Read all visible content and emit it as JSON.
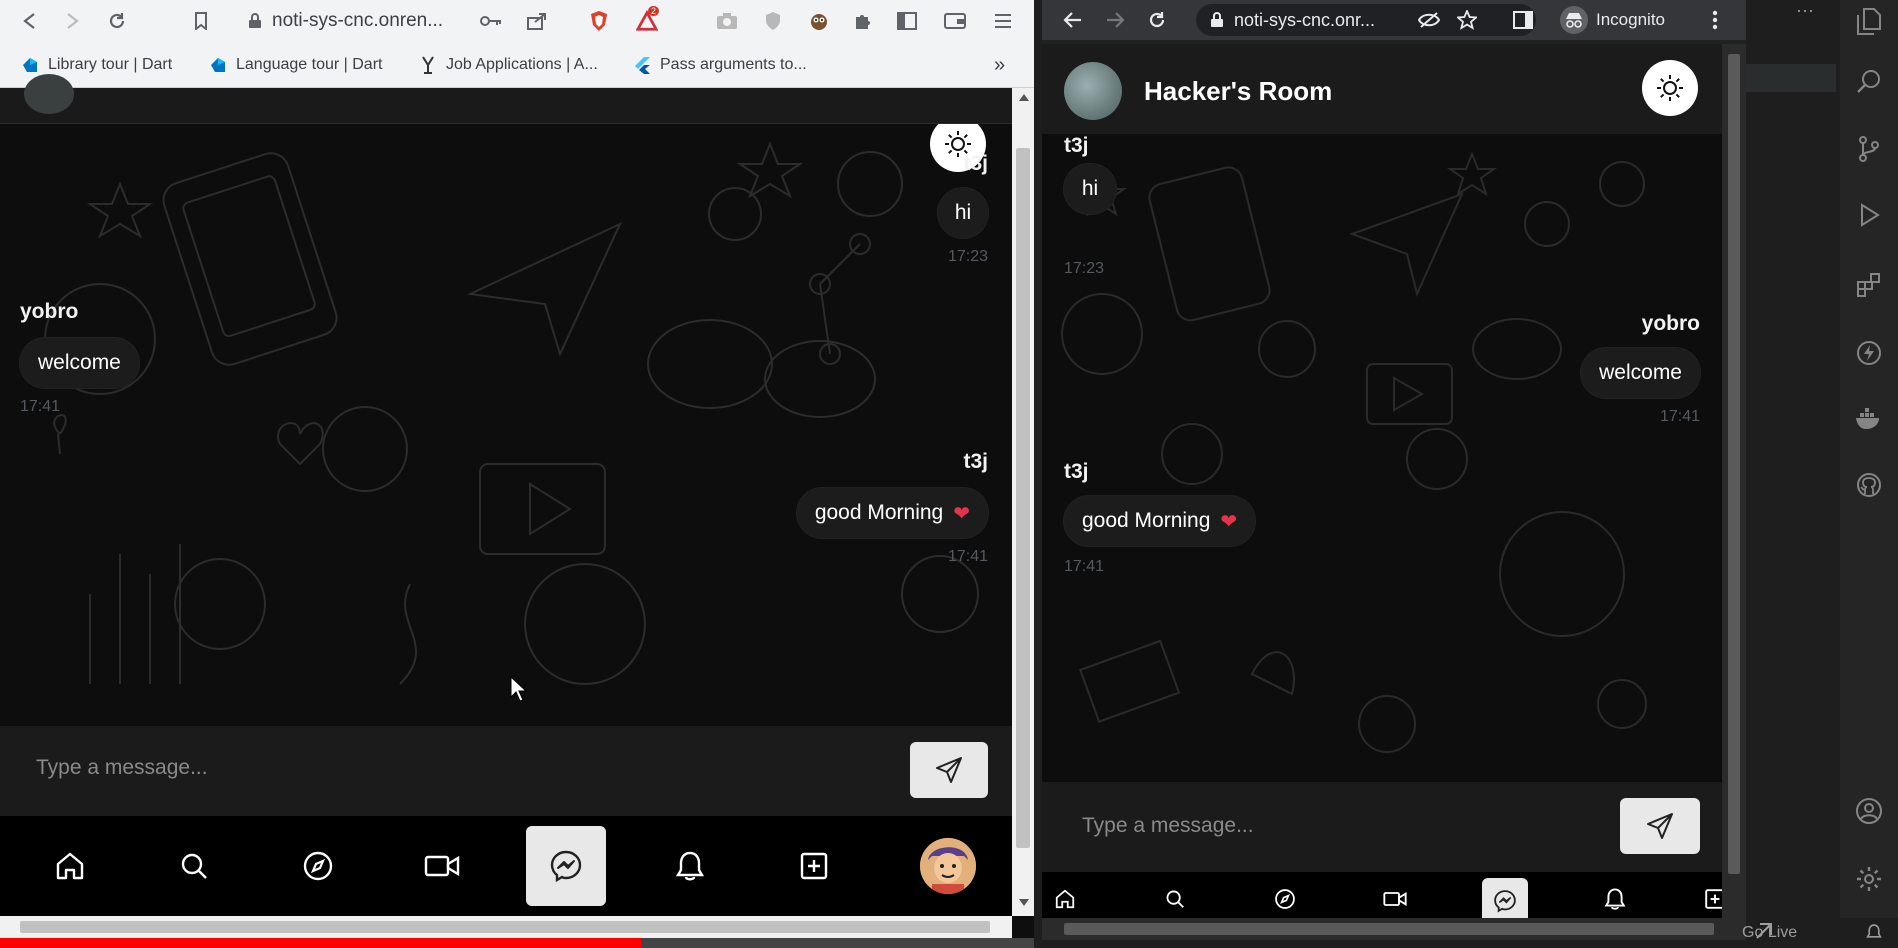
{
  "left_window": {
    "url": "noti-sys-cnc.onren...",
    "extension_badge": "2",
    "bookmarks": [
      {
        "label": "Library tour | Dart",
        "icon": "dart-icon"
      },
      {
        "label": "Language tour | Dart",
        "icon": "dart-icon"
      },
      {
        "label": "Job Applications | A...",
        "icon": "job-icon"
      },
      {
        "label": "Pass arguments to...",
        "icon": "flutter-icon"
      }
    ],
    "bookmarks_more": "»",
    "messages": [
      {
        "sender": "t3j",
        "text": "hi",
        "time": "17:23",
        "side": "right"
      },
      {
        "sender": "yobro",
        "text": "welcome",
        "time": "17:41",
        "side": "left"
      },
      {
        "sender": "t3j",
        "text": "good Morning",
        "emoji": "❤",
        "time": "17:41",
        "side": "right"
      }
    ],
    "input_placeholder": "Type a message...",
    "nav": [
      "home",
      "search",
      "explore",
      "video",
      "messenger",
      "notifications",
      "add",
      "profile"
    ],
    "active_nav": "messenger",
    "video_progress": 0.62
  },
  "right_window": {
    "url": "noti-sys-cnc.onr...",
    "incognito_label": "Incognito",
    "room_title": "Hacker's Room",
    "messages": [
      {
        "sender": "t3j",
        "text": "hi",
        "time": "17:23",
        "side": "left"
      },
      {
        "sender": "yobro",
        "text": "welcome",
        "time": "17:41",
        "side": "right"
      },
      {
        "sender": "t3j",
        "text": "good Morning",
        "emoji": "❤",
        "time": "17:41",
        "side": "left"
      }
    ],
    "input_placeholder": "Type a message...",
    "active_nav": "messenger"
  },
  "vscode": {
    "status_text": "Go Live",
    "overflow_label": "···"
  }
}
